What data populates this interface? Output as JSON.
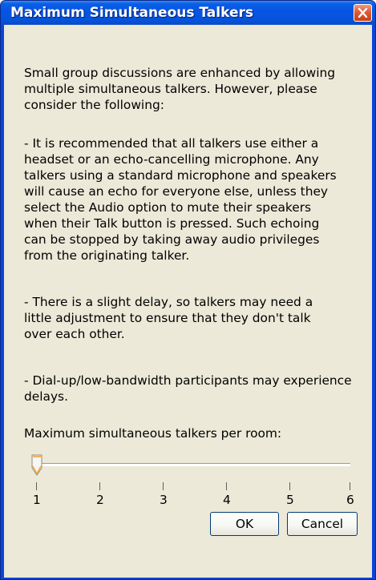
{
  "window": {
    "title": "Maximum Simultaneous Talkers"
  },
  "body": {
    "intro": "Small group discussions are enhanced by allowing\nmultiple simultaneous talkers.  However, please\nconsider the following:",
    "bullet_1": "- It is recommended that all talkers use either a\n  headset or an echo-cancelling microphone.  Any\n  talkers using a standard microphone and speakers\n  will cause an echo for everyone else, unless they\n  select the Audio option to mute their speakers\n  when their Talk button is pressed.  Such echoing\n  can be stopped by taking away audio privileges\n  from the originating talker.",
    "bullet_2": "- There is a slight delay, so talkers may need a\n  little adjustment to ensure that they don't talk\n  over each other.",
    "bullet_3": "- Dial-up/low-bandwidth participants may experience\n  delays."
  },
  "slider": {
    "label": "Maximum simultaneous talkers per room:",
    "min": 1,
    "max": 6,
    "value": 1,
    "ticks": [
      "1",
      "2",
      "3",
      "4",
      "5",
      "6"
    ]
  },
  "buttons": {
    "ok": "OK",
    "cancel": "Cancel"
  },
  "colors": {
    "title_bar": "#0654e2",
    "dialog_background": "#ece9d8",
    "close_button": "#dd5c36"
  },
  "icons": {
    "close": "close-icon",
    "thumb": "slider-thumb"
  }
}
